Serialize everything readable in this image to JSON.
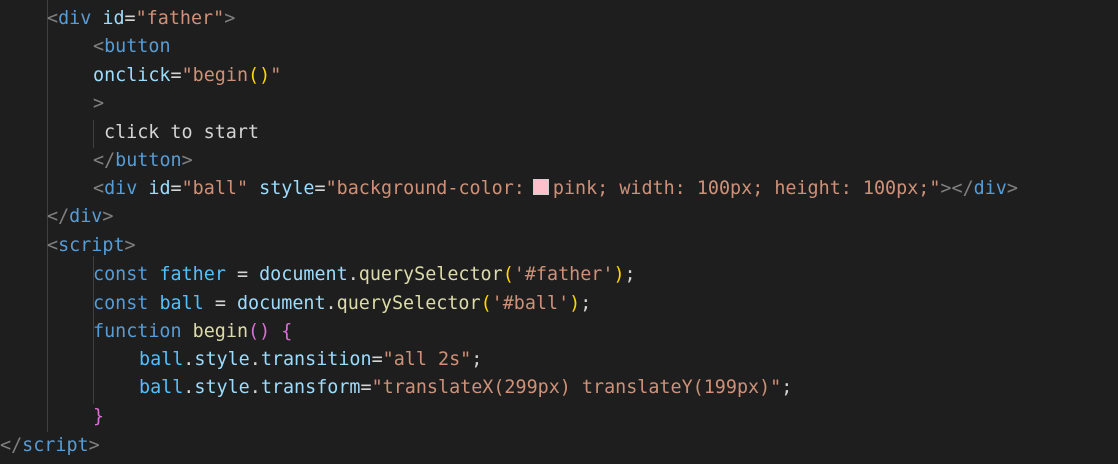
{
  "code_lines": [
    {
      "tokens": [
        {
          "t": "<",
          "c": "bracket"
        },
        {
          "t": "div",
          "c": "tag"
        },
        {
          "t": " ",
          "c": "text"
        },
        {
          "t": "id",
          "c": "attr"
        },
        {
          "t": "=",
          "c": "punct"
        },
        {
          "t": "\"father\"",
          "c": "str"
        },
        {
          "t": ">",
          "c": "bracket"
        }
      ]
    },
    {
      "tokens": [
        {
          "t": "<",
          "c": "bracket"
        },
        {
          "t": "button",
          "c": "tag"
        }
      ]
    },
    {
      "tokens": [
        {
          "t": "onclick",
          "c": "attr"
        },
        {
          "t": "=",
          "c": "punct"
        },
        {
          "t": "\"begin",
          "c": "str"
        },
        {
          "t": "()",
          "c": "paren"
        },
        {
          "t": "\"",
          "c": "str"
        }
      ]
    },
    {
      "tokens": [
        {
          "t": ">",
          "c": "bracket"
        }
      ]
    },
    {
      "tokens": [
        {
          "t": "click to start",
          "c": "text"
        }
      ]
    },
    {
      "tokens": [
        {
          "t": "</",
          "c": "bracket"
        },
        {
          "t": "button",
          "c": "tag"
        },
        {
          "t": ">",
          "c": "bracket"
        }
      ]
    },
    {
      "tokens": [
        {
          "t": "<",
          "c": "bracket"
        },
        {
          "t": "div",
          "c": "tag"
        },
        {
          "t": " ",
          "c": "text"
        },
        {
          "t": "id",
          "c": "attr"
        },
        {
          "t": "=",
          "c": "punct"
        },
        {
          "t": "\"ball\"",
          "c": "str"
        },
        {
          "t": " ",
          "c": "text"
        },
        {
          "t": "style",
          "c": "attr"
        },
        {
          "t": "=",
          "c": "punct"
        },
        {
          "t": "\"background-color:",
          "c": "str"
        },
        {
          "t": "",
          "c": "swatch"
        },
        {
          "t": "pink; width: 100px; height: 100px;\"",
          "c": "str"
        },
        {
          "t": "></",
          "c": "bracket"
        },
        {
          "t": "div",
          "c": "tag"
        },
        {
          "t": ">",
          "c": "bracket"
        }
      ]
    },
    {
      "tokens": [
        {
          "t": "</",
          "c": "bracket"
        },
        {
          "t": "div",
          "c": "tag"
        },
        {
          "t": ">",
          "c": "bracket"
        }
      ]
    },
    {
      "tokens": [
        {
          "t": "<",
          "c": "bracket"
        },
        {
          "t": "script",
          "c": "tag"
        },
        {
          "t": ">",
          "c": "bracket"
        }
      ]
    },
    {
      "tokens": [
        {
          "t": "const",
          "c": "kw"
        },
        {
          "t": " ",
          "c": "text"
        },
        {
          "t": "father",
          "c": "var"
        },
        {
          "t": " = ",
          "c": "punct"
        },
        {
          "t": "document",
          "c": "prop"
        },
        {
          "t": ".",
          "c": "punct"
        },
        {
          "t": "querySelector",
          "c": "fn"
        },
        {
          "t": "(",
          "c": "paren"
        },
        {
          "t": "'#father'",
          "c": "str"
        },
        {
          "t": ")",
          "c": "paren"
        },
        {
          "t": ";",
          "c": "punct"
        }
      ]
    },
    {
      "tokens": [
        {
          "t": "const",
          "c": "kw"
        },
        {
          "t": " ",
          "c": "text"
        },
        {
          "t": "ball",
          "c": "var"
        },
        {
          "t": " = ",
          "c": "punct"
        },
        {
          "t": "document",
          "c": "prop"
        },
        {
          "t": ".",
          "c": "punct"
        },
        {
          "t": "querySelector",
          "c": "fn"
        },
        {
          "t": "(",
          "c": "paren"
        },
        {
          "t": "'#ball'",
          "c": "str"
        },
        {
          "t": ")",
          "c": "paren"
        },
        {
          "t": ";",
          "c": "punct"
        }
      ]
    },
    {
      "tokens": [
        {
          "t": "function",
          "c": "kw"
        },
        {
          "t": " ",
          "c": "text"
        },
        {
          "t": "begin",
          "c": "fn"
        },
        {
          "t": "()",
          "c": "paren2"
        },
        {
          "t": " ",
          "c": "text"
        },
        {
          "t": "{",
          "c": "paren2"
        }
      ]
    },
    {
      "tokens": [
        {
          "t": "ball",
          "c": "var"
        },
        {
          "t": ".",
          "c": "punct"
        },
        {
          "t": "style",
          "c": "prop"
        },
        {
          "t": ".",
          "c": "punct"
        },
        {
          "t": "transition",
          "c": "prop"
        },
        {
          "t": "=",
          "c": "punct"
        },
        {
          "t": "\"all 2s\"",
          "c": "str"
        },
        {
          "t": ";",
          "c": "punct"
        }
      ]
    },
    {
      "tokens": [
        {
          "t": "ball",
          "c": "var"
        },
        {
          "t": ".",
          "c": "punct"
        },
        {
          "t": "style",
          "c": "prop"
        },
        {
          "t": ".",
          "c": "punct"
        },
        {
          "t": "transform",
          "c": "prop"
        },
        {
          "t": "=",
          "c": "punct"
        },
        {
          "t": "\"translateX(299px) translateY(199px)\"",
          "c": "str"
        },
        {
          "t": ";",
          "c": "punct"
        }
      ]
    },
    {
      "tokens": [
        {
          "t": "}",
          "c": "paren2"
        }
      ]
    },
    {
      "tokens": [
        {
          "t": "</",
          "c": "bracket"
        },
        {
          "t": "script",
          "c": "tag"
        },
        {
          "t": ">",
          "c": "bracket"
        }
      ]
    }
  ],
  "colors": {
    "background": "#1e1e1e",
    "tag": "#569cd6",
    "attribute": "#9cdcfe",
    "string": "#ce9178",
    "function": "#dcdcaa",
    "swatch": "#ffc0cb"
  }
}
